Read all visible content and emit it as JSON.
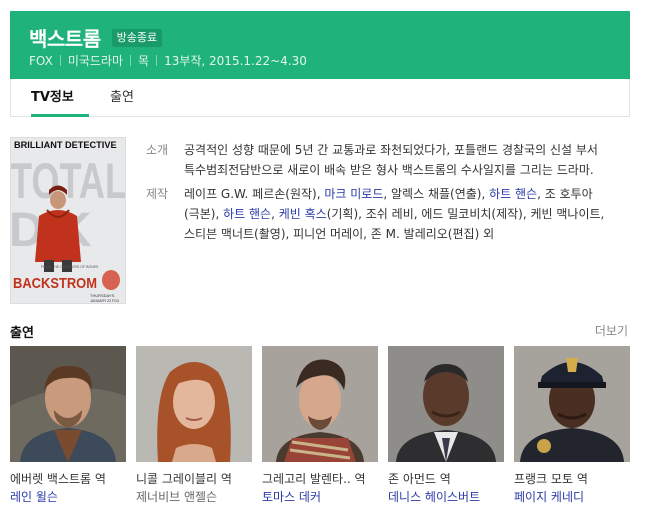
{
  "show": {
    "title": "백스트롬",
    "status_badge": "방송종료",
    "network": "FOX",
    "genre": "미국드라마",
    "day": "목",
    "episodes_dates": "13부작, 2015.1.22~4.30"
  },
  "tabs": [
    {
      "label": "TV정보",
      "active": true
    },
    {
      "label": "출연",
      "active": false
    }
  ],
  "poster": {
    "line1": "BRILLIANT DETECTIVE",
    "line2": "TOTAL",
    "line3": "D K",
    "title": "BACKSTROM",
    "small_top": "FROM THE CREATORS OF BONES",
    "small_bottom1": "THURSDAYS",
    "small_bottom2": "JANUARY 22 FOX"
  },
  "info": {
    "synopsis_label": "소개",
    "synopsis": "공격적인 성향 때문에 5년 간 교통과로 좌천되었다가, 포틀랜드 경찰국의 신설 부서 특수범죄전담반으로 새로이 배속 받은 형사 백스트롬의 수사일지를 그리는 드라마.",
    "production_label": "제작",
    "production": [
      {
        "text": "레이프 G.W. 페르손(원작), ",
        "link": false
      },
      {
        "text": "마크 미로드",
        "link": true
      },
      {
        "text": ", 알렉스 채플(연출), ",
        "link": false
      },
      {
        "text": "하트 핸슨",
        "link": true
      },
      {
        "text": ", 조 호투아(극본), ",
        "link": false
      },
      {
        "text": "하트 핸슨",
        "link": true
      },
      {
        "text": ", ",
        "link": false
      },
      {
        "text": "케빈 혹스",
        "link": true
      },
      {
        "text": "(기획), 조쉬 레비, 에드 밀코비치(제작), 케빈 맥나이트, 스티븐 맥너트(촬영), 피니언 머레이, 존 M. 발레리오(편집) 외",
        "link": false
      }
    ]
  },
  "cast_section": {
    "heading": "출연",
    "more": "더보기"
  },
  "cast": [
    {
      "role": "에버렛 백스트롬 역",
      "actor": "레인 윌슨",
      "actor_link": true
    },
    {
      "role": "니콜 그레이블리 역",
      "actor": "제너비브 앤젤슨",
      "actor_link": false
    },
    {
      "role": "그레고리 발렌타.. 역",
      "actor": "토마스 데커",
      "actor_link": true
    },
    {
      "role": "존 아먼드 역",
      "actor": "데니스 헤이스버트",
      "actor_link": true
    },
    {
      "role": "프랭크 모토 역",
      "actor": "페이지 케네디",
      "actor_link": true
    }
  ],
  "colors": {
    "brand_green": "#1fb27a",
    "link_blue": "#2a3aa8"
  }
}
